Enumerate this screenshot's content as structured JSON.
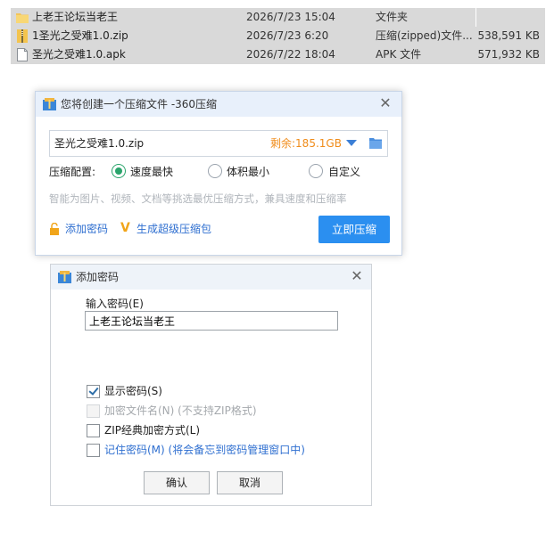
{
  "file_list": {
    "rows": [
      {
        "name": "上老王论坛当老王",
        "date": "2026/7/23 15:04",
        "type": "文件夹",
        "size": "",
        "icon": "folder-icon",
        "selected": true
      },
      {
        "name": "1圣光之受难1.0.zip",
        "date": "2026/7/23 6:20",
        "type": "压缩(zipped)文件...",
        "size": "538,591 KB",
        "icon": "zip-icon",
        "selected": true
      },
      {
        "name": "圣光之受难1.0.apk",
        "date": "2026/7/22 18:04",
        "type": "APK 文件",
        "size": "571,932 KB",
        "icon": "file-icon",
        "selected": true
      }
    ]
  },
  "compress_dialog": {
    "title": "您将创建一个压缩文件 -360压缩",
    "close": "✕",
    "filename": "圣光之受难1.0.zip",
    "free_space": "剩余:185.1GB",
    "config_label": "压缩配置:",
    "options": [
      {
        "label": "速度最快",
        "selected": true
      },
      {
        "label": "体积最小",
        "selected": false
      },
      {
        "label": "自定义",
        "selected": false
      }
    ],
    "hint": "智能为图片、视频、文档等挑选最优压缩方式，兼具速度和压缩率",
    "add_password": "添加密码",
    "super_package": "生成超级压缩包",
    "start_button": "立即压缩",
    "accent_color": "#2b8ff0"
  },
  "password_dialog": {
    "title": "添加密码",
    "close": "✕",
    "input_label": "输入密码(E)",
    "password_value": "上老王论坛当老王",
    "checkboxes": [
      {
        "label": "显示密码(S)",
        "checked": true,
        "enabled": true
      },
      {
        "label": "加密文件名(N) (不支持ZIP格式)",
        "checked": false,
        "enabled": false
      },
      {
        "label": "ZIP经典加密方式(L)",
        "checked": false,
        "enabled": true
      },
      {
        "label": "记住密码(M) (将会备忘到密码管理窗口中)",
        "checked": false,
        "enabled": true
      }
    ],
    "ok_button": "确认",
    "cancel_button": "取消"
  }
}
